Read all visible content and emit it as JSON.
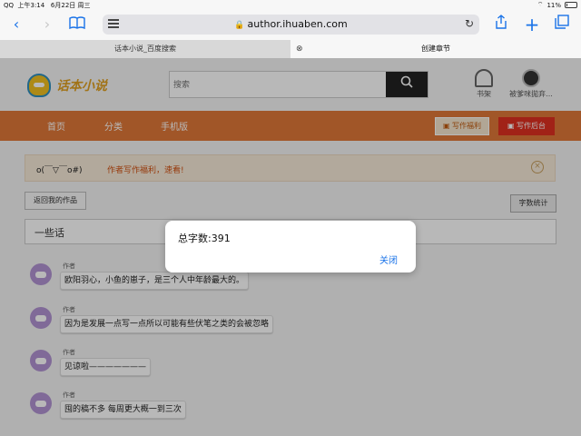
{
  "status": {
    "carrier": "QQ",
    "time": "上午3:14",
    "date": "6月22日 周三",
    "battery": "11%",
    "battery_level": 0.11
  },
  "browser": {
    "url": "author.ihuaben.com",
    "tabs": [
      {
        "title": "话本小说_百度搜索",
        "active": false
      },
      {
        "title": "创建章节",
        "active": true
      }
    ]
  },
  "site": {
    "logo_text": "话本小说",
    "search_placeholder": "搜索",
    "shelf_label": "书架",
    "user_label": "被爹咪拋弃...",
    "nav": [
      "首页",
      "分类",
      "手机版"
    ],
    "welfare_btn": "写作福利",
    "backend_btn": "写作后台",
    "notice_emoticon": "o(￣▽￣o#)",
    "notice_text": "作者写作福利，速看!",
    "back_btn": "返回我的作品",
    "count_btn": "字数统计",
    "chapter_title": "一些话"
  },
  "messages": [
    {
      "author": "作者",
      "text": "欧阳羽心，小鱼的崽子，是三个人中年龄最大的。"
    },
    {
      "author": "作者",
      "text": "因为是发展一点写一点所以可能有些伏笔之类的会被忽略"
    },
    {
      "author": "作者",
      "text": "见谅啦———————"
    },
    {
      "author": "作者",
      "text": "囤的稿不多 每周更大概一到三次"
    }
  ],
  "alert": {
    "text": "总字数:391",
    "close": "关闭"
  }
}
